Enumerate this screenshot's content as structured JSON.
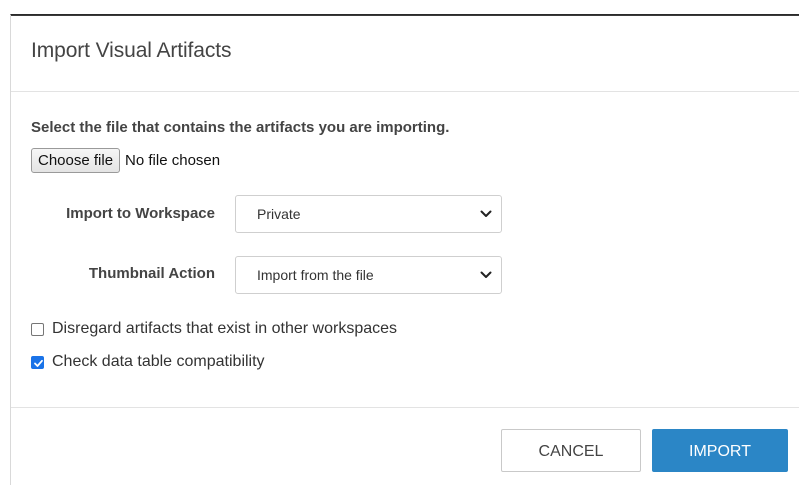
{
  "dialog": {
    "title": "Import Visual Artifacts"
  },
  "file_picker": {
    "instructions": "Select the file that contains the artifacts you are importing.",
    "button_label": "Choose file",
    "status": "No file chosen"
  },
  "form": {
    "workspace": {
      "label": "Import to Workspace",
      "value": "Private"
    },
    "thumbnail": {
      "label": "Thumbnail Action",
      "value": "Import from the file"
    }
  },
  "options": {
    "disregard": {
      "label": "Disregard artifacts that exist in other workspaces",
      "checked": false
    },
    "compatibility": {
      "label": "Check data table compatibility",
      "checked": true
    }
  },
  "footer": {
    "cancel_label": "CANCEL",
    "import_label": "IMPORT"
  },
  "colors": {
    "primary": "#2b86c6",
    "checkbox_checked": "#1a73e8"
  },
  "icons": {
    "select_chevron": "chevron-down-icon",
    "checkmark": "checkmark-icon"
  }
}
